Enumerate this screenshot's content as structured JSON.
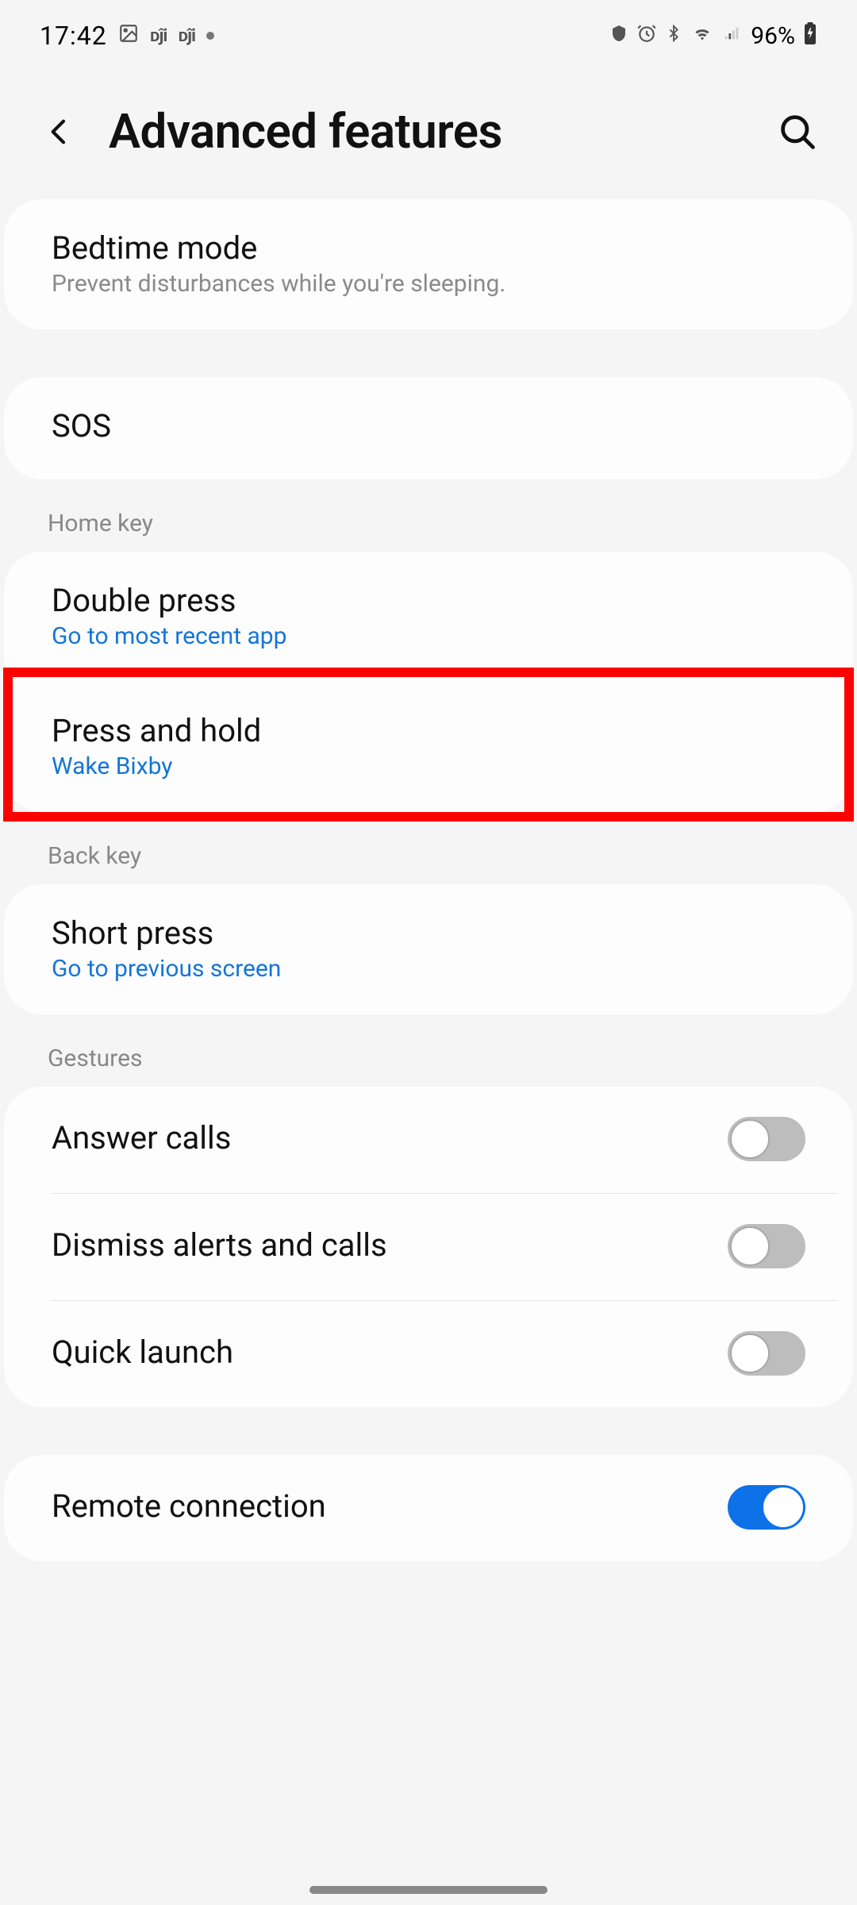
{
  "status": {
    "time": "17:42",
    "battery": "96%"
  },
  "header": {
    "title": "Advanced features"
  },
  "cards": {
    "bedtime": {
      "title": "Bedtime mode",
      "sub": "Prevent disturbances while you're sleeping."
    },
    "sos": {
      "title": "SOS"
    }
  },
  "home_key": {
    "label": "Home key",
    "double": {
      "title": "Double press",
      "sub": "Go to most recent app"
    },
    "hold": {
      "title": "Press and hold",
      "sub": "Wake Bixby"
    }
  },
  "back_key": {
    "label": "Back key",
    "short": {
      "title": "Short press",
      "sub": "Go to previous screen"
    }
  },
  "gestures": {
    "label": "Gestures",
    "answer": {
      "title": "Answer calls",
      "on": false
    },
    "dismiss": {
      "title": "Dismiss alerts and calls",
      "on": false
    },
    "quick": {
      "title": "Quick launch",
      "on": false
    }
  },
  "remote": {
    "title": "Remote connection",
    "on": true
  }
}
